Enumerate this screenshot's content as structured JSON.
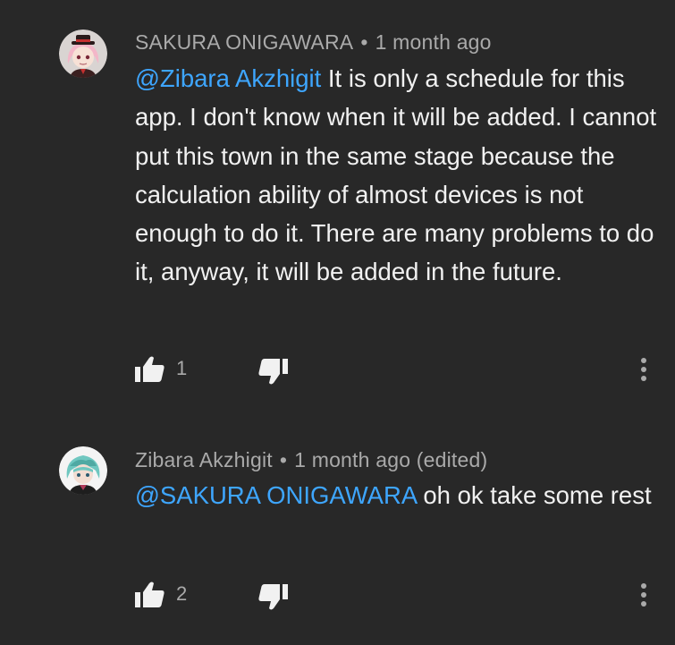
{
  "comments": [
    {
      "author": "SAKURA ONIGAWARA",
      "separator": "•",
      "time": "1 month ago",
      "mention": "@Zibara Akzhigit",
      "text": " It is only a schedule for this app. I don't know when it will be added. I cannot put this town in the same stage because the calculation ability of almost devices is not enough to do it. There are many problems to do it, anyway, it will be added in the future.",
      "likes": "1",
      "avatar_icon": "anime-avatar-pink-hair-top-hat"
    },
    {
      "author": "Zibara Akzhigit",
      "separator": "•",
      "time": "1 month ago (edited)",
      "mention": "@SAKURA ONIGAWARA",
      "text": " oh ok take some rest",
      "likes": "2",
      "avatar_icon": "anime-avatar-green-hair"
    }
  ],
  "icons": {
    "like": "thumbs-up-icon",
    "dislike": "thumbs-down-icon",
    "more": "more-vertical-icon"
  },
  "colors": {
    "background": "#282828",
    "text": "#f1f1f1",
    "meta": "#aaaaaa",
    "mention": "#3ea6ff"
  }
}
